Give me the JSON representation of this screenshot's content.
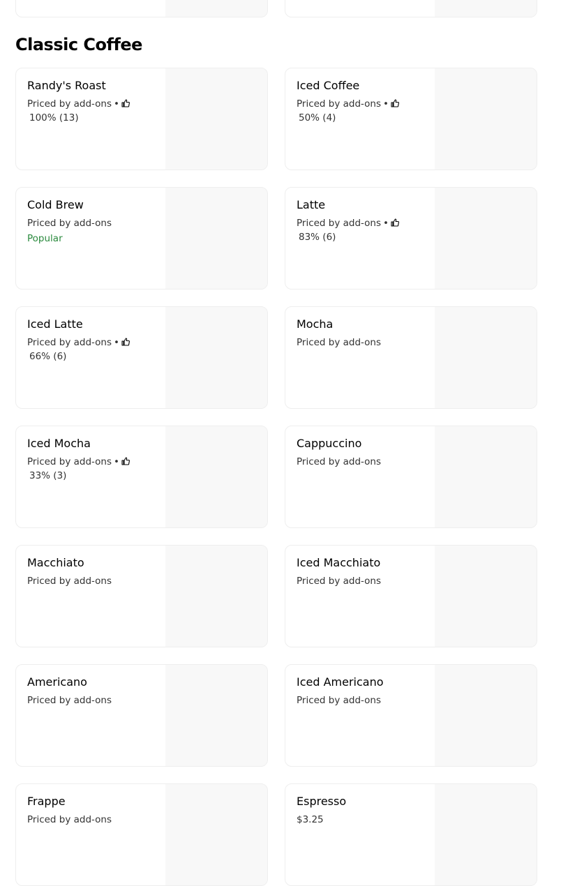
{
  "section": {
    "title": "Classic Coffee"
  },
  "items": [
    {
      "name": "Randy's Roast",
      "price": "Priced by add-ons",
      "rating": "100% (13)"
    },
    {
      "name": "Iced Coffee",
      "price": "Priced by add-ons",
      "rating": "50% (4)"
    },
    {
      "name": "Cold Brew",
      "price": "Priced by add-ons",
      "badge": "Popular"
    },
    {
      "name": "Latte",
      "price": "Priced by add-ons",
      "rating": "83% (6)"
    },
    {
      "name": "Iced Latte",
      "price": "Priced by add-ons",
      "rating": "66% (6)"
    },
    {
      "name": "Mocha",
      "price": "Priced by add-ons"
    },
    {
      "name": "Iced Mocha",
      "price": "Priced by add-ons",
      "rating": "33% (3)"
    },
    {
      "name": "Cappuccino",
      "price": "Priced by add-ons"
    },
    {
      "name": "Macchiato",
      "price": "Priced by add-ons"
    },
    {
      "name": "Iced Macchiato",
      "price": "Priced by add-ons"
    },
    {
      "name": "Americano",
      "price": "Priced by add-ons"
    },
    {
      "name": "Iced Americano",
      "price": "Priced by add-ons"
    },
    {
      "name": "Frappe",
      "price": "Priced by add-ons"
    },
    {
      "name": "Espresso",
      "price": "$3.25"
    }
  ],
  "separator": "•",
  "colors": {
    "popular_badge": "#2b8a3e",
    "image_placeholder": "#f8f8f8",
    "card_border": "#eeeeee"
  },
  "icons": {
    "rating": "thumbs-up-icon"
  }
}
